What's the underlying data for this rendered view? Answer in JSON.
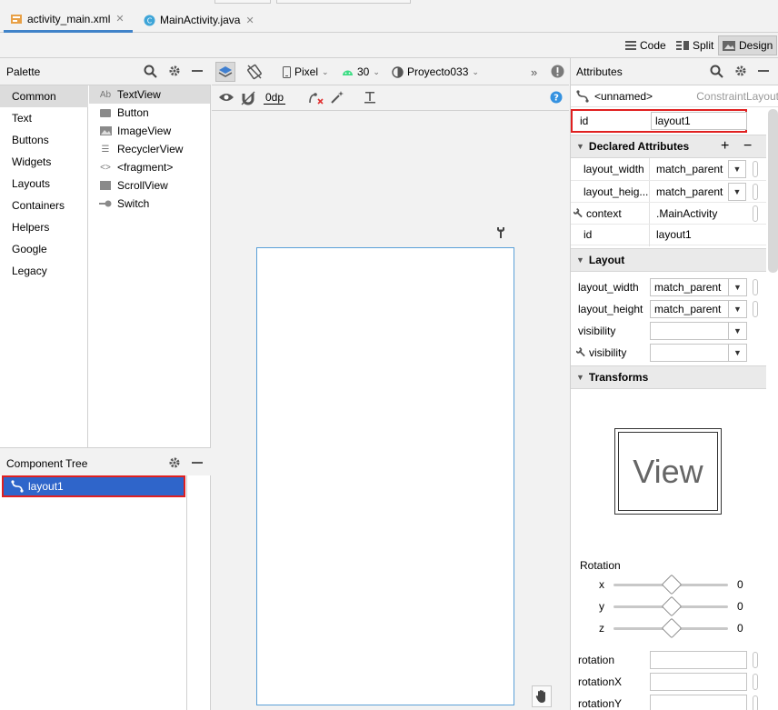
{
  "tabs": [
    {
      "label": "activity_main.xml",
      "icon": "layout-xml-icon",
      "close": "✕"
    },
    {
      "label": "MainActivity.java",
      "icon": "java-class-icon",
      "close": "✕"
    }
  ],
  "modes": {
    "code": "Code",
    "split": "Split",
    "design": "Design"
  },
  "palette": {
    "title": "Palette",
    "categories": [
      "Common",
      "Text",
      "Buttons",
      "Widgets",
      "Layouts",
      "Containers",
      "Helpers",
      "Google",
      "Legacy"
    ],
    "items": [
      {
        "label": "TextView",
        "icon": "textview-icon",
        "glyph": "Ab"
      },
      {
        "label": "Button",
        "icon": "button-icon",
        "glyph": ""
      },
      {
        "label": "ImageView",
        "icon": "image-icon",
        "glyph": ""
      },
      {
        "label": "RecyclerView",
        "icon": "list-icon",
        "glyph": "☰"
      },
      {
        "label": "<fragment>",
        "icon": "code-brackets-icon",
        "glyph": "<>"
      },
      {
        "label": "ScrollView",
        "icon": "scrollview-icon",
        "glyph": ""
      },
      {
        "label": "Switch",
        "icon": "switch-icon",
        "glyph": ""
      }
    ]
  },
  "component_tree": {
    "title": "Component Tree",
    "root": "layout1"
  },
  "design_toolbar": {
    "device": "Pixel",
    "api": "30",
    "theme": "Proyecto033",
    "margin": "0dp"
  },
  "attributes": {
    "title": "Attributes",
    "component_name": "<unnamed>",
    "component_type": "ConstraintLayout",
    "id_label": "id",
    "id_value": "layout1",
    "declared_title": "Declared Attributes",
    "declared": [
      {
        "name": "layout_width",
        "value": "match_parent",
        "dropdown": true
      },
      {
        "name": "layout_heig...",
        "value": "match_parent",
        "dropdown": true
      },
      {
        "name": "context",
        "value": ".MainActivity",
        "dropdown": false,
        "tool": true
      },
      {
        "name": "id",
        "value": "layout1",
        "dropdown": false
      }
    ],
    "layout_title": "Layout",
    "layout": [
      {
        "name": "layout_width",
        "value": "match_parent"
      },
      {
        "name": "layout_height",
        "value": "match_parent"
      },
      {
        "name": "visibility",
        "value": ""
      },
      {
        "name": "visibility",
        "value": "",
        "tool": true
      }
    ],
    "transforms_title": "Transforms",
    "view_preview": "View",
    "rotation_title": "Rotation",
    "rotation_axes": [
      {
        "axis": "x",
        "value": "0"
      },
      {
        "axis": "y",
        "value": "0"
      },
      {
        "axis": "z",
        "value": "0"
      }
    ],
    "rotation_fields": [
      "rotation",
      "rotationX",
      "rotationY"
    ]
  }
}
